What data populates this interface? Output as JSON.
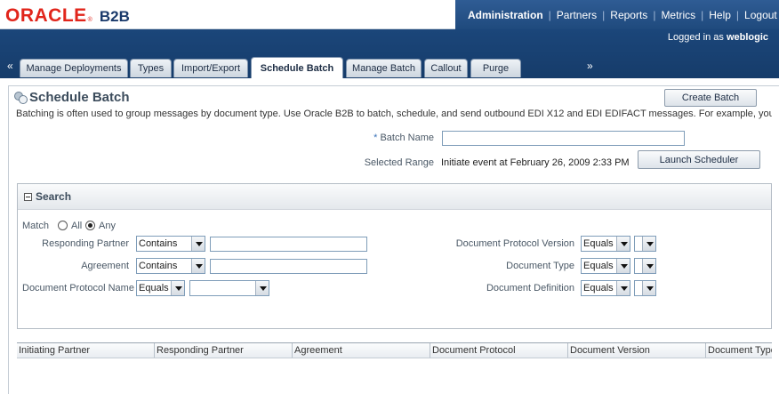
{
  "brand": {
    "oracle": "ORACLE",
    "reg": "®",
    "product": "B2B"
  },
  "globalnav": {
    "items": [
      "Administration",
      "Partners",
      "Reports",
      "Metrics",
      "Help",
      "Logout"
    ],
    "logged_prefix": "Logged in as",
    "user": "weblogic"
  },
  "tabs": [
    "Manage Deployments",
    "Types",
    "Import/Export",
    "Schedule Batch",
    "Manage Batch",
    "Callout",
    "Purge"
  ],
  "active_tab": "Schedule Batch",
  "tab_scroll": {
    "left": "«",
    "right": "»"
  },
  "page": {
    "title": "Schedule Batch",
    "create_button": "Create Batch",
    "description": "Batching is often used to group messages by document type. Use Oracle B2B to batch, schedule, and send outbound EDI X12 and EDI EDIFACT messages. For example, you may"
  },
  "form": {
    "required_mark": "*",
    "batch_name_label": "Batch Name",
    "batch_name_value": "",
    "selected_range_label": "Selected Range",
    "selected_range_value": "Initiate event at February 26, 2009 2:33 PM",
    "launch_button": "Launch Scheduler"
  },
  "search": {
    "title": "Search",
    "match_label": "Match",
    "match_all": "All",
    "match_any": "Any",
    "match_selected": "Any",
    "responding_partner_label": "Responding Partner",
    "responding_partner_op": "Contains",
    "agreement_label": "Agreement",
    "agreement_op": "Contains",
    "doc_protocol_name_label": "Document Protocol Name",
    "doc_protocol_name_op": "Equals",
    "doc_protocol_version_label": "Document Protocol Version",
    "doc_protocol_version_op": "Equals",
    "document_type_label": "Document Type",
    "document_type_op": "Equals",
    "document_definition_label": "Document Definition",
    "document_definition_op": "Equals"
  },
  "table": {
    "columns": [
      "Initiating Partner",
      "Responding Partner",
      "Agreement",
      "Document Protocol",
      "Document Version",
      "Document Type"
    ]
  }
}
